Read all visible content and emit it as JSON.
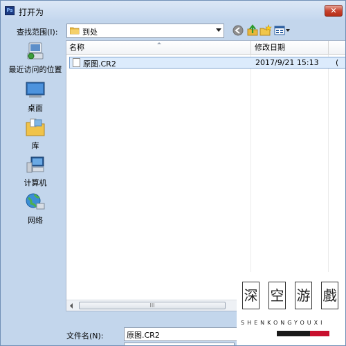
{
  "title_bar": {
    "app_icon_text": "Ps",
    "title": "打开为",
    "close_glyph": "✕"
  },
  "toolbar": {
    "look_in_label": "查找范围(I):",
    "look_in_value": "到处",
    "icons": [
      "back-icon",
      "up-folder-icon",
      "new-folder-icon",
      "view-menu-icon"
    ]
  },
  "places": [
    {
      "label": "最近访问的位置",
      "icon": "recent-places-icon"
    },
    {
      "label": "桌面",
      "icon": "desktop-icon"
    },
    {
      "label": "库",
      "icon": "libraries-icon"
    },
    {
      "label": "计算机",
      "icon": "computer-icon"
    },
    {
      "label": "网络",
      "icon": "network-icon"
    }
  ],
  "file_list": {
    "columns": [
      "名称",
      "修改日期"
    ],
    "rows": [
      {
        "name": "原图.CR2",
        "modified": "2017/9/21 15:13",
        "truncated": "("
      }
    ]
  },
  "scrollbar": {
    "thumb_grip": "III"
  },
  "bottom": {
    "file_name_label": "文件名(N):",
    "file_name_value": "原图.CR2"
  },
  "watermark": {
    "chars": [
      "深",
      "空",
      "游",
      "戲"
    ],
    "sub": "SHENKONGYOUXI",
    "colors": {
      "bar1": "#1a1a1a",
      "bar2": "#c8102e"
    }
  },
  "colors": {
    "accent": "#c8102e",
    "selection": "#dcebfc",
    "frame": "#c3d6ec"
  }
}
